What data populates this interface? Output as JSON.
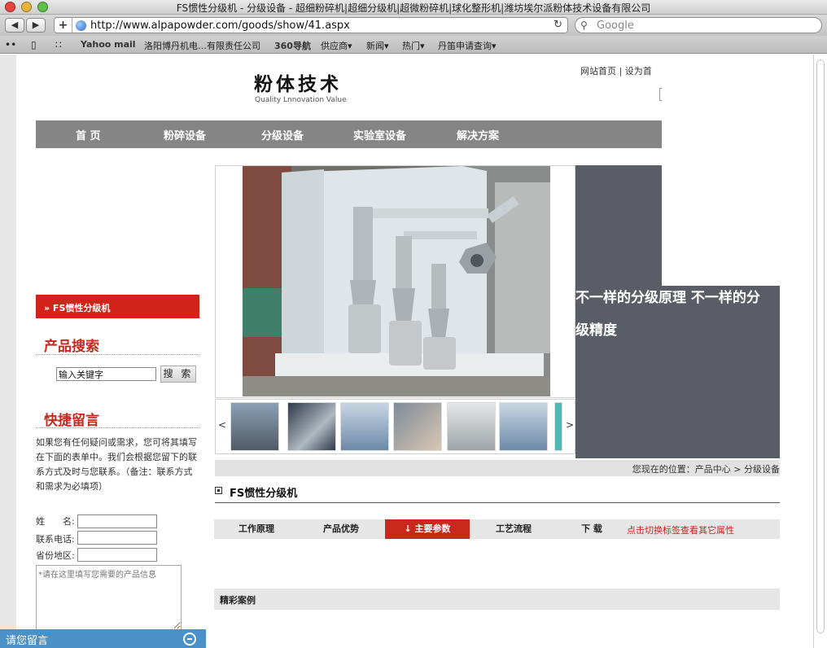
{
  "window": {
    "title": "FS惯性分级机 - 分级设备 - 超细粉碎机|超细分级机|超微粉碎机|球化整形机|潍坊埃尔派粉体技术设备有限公司"
  },
  "toolbar": {
    "url": "http://www.alpapowder.com/goods/show/41.aspx",
    "search_placeholder": "Google",
    "reload_icon": "↻",
    "back_icon": "◀",
    "forward_icon": "▶",
    "add_icon": "+"
  },
  "bookmarks": {
    "items": [
      "Yahoo mail",
      "洛阳博丹机电…有限责任公司",
      "360导航",
      "供应商▾",
      "新闻▾",
      "热门▾",
      "丹笛申请查询▾"
    ]
  },
  "header": {
    "logo_main": "粉体技术",
    "logo_sub": "Quality Lnnovation Value",
    "top_links": "网站首页 | 设为首"
  },
  "nav": {
    "items": [
      "首 页",
      "粉碎设备",
      "分级设备",
      "实验室设备",
      "解决方案"
    ]
  },
  "banner": {
    "slogan": "不一样的分级原理 不一样的分级精度",
    "prev_arrow": "<",
    "next_arrow": ">"
  },
  "breadcrumb": {
    "text": "您现在的位置：产品中心 > 分级设备"
  },
  "product": {
    "title": "FS惯性分级机"
  },
  "tabs": {
    "items": [
      "工作原理",
      "产品优势",
      "↓ 主要参数",
      "工艺流程",
      "下 载"
    ],
    "active_index": 2,
    "hint": "点击切换标签查看其它属性"
  },
  "cases": {
    "title": "精彩案例"
  },
  "sidebar": {
    "current_product": "» FS惯性分级机",
    "search_title": "产品搜索",
    "search_value": "输入关键字",
    "search_button": "搜 索",
    "message_title": "快捷留言",
    "message_intro": "如果您有任何疑问或需求，您可将其填写在下面的表单中。我们会根据您留下的联系方式及时与您联系。（备注：联系方式和需求为必填项）",
    "name_label": "姓　　名:",
    "phone_label": "联系电话:",
    "region_label": "省份地区:",
    "message_placeholder": "*请在这里填写您需要的产品信息"
  },
  "chat": {
    "label": "请您留言",
    "icon": "minimize-icon"
  },
  "colors": {
    "accent_red": "#d1231a",
    "nav_gray": "#858585",
    "panel_dark": "#5a5d66",
    "chat_blue": "#4a90c9"
  }
}
